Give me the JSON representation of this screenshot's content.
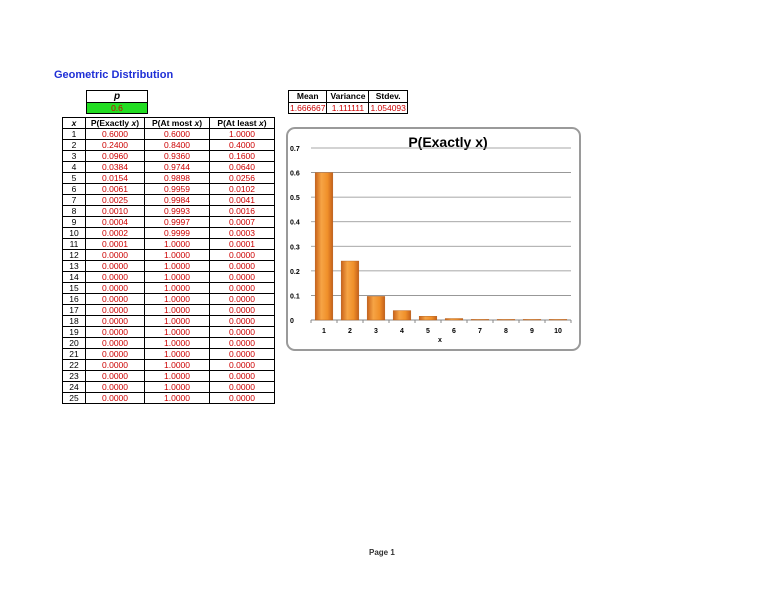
{
  "title": "Geometric Distribution",
  "param": {
    "label": "p",
    "value": "0.6"
  },
  "stats": {
    "headers": [
      "Mean",
      "Variance",
      "Stdev."
    ],
    "values": [
      "1.666667",
      "1.111111",
      "1.054093"
    ]
  },
  "table": {
    "headers": {
      "x": "x",
      "exactly_pre": "P(Exactly ",
      "atmost_pre": "P(At most ",
      "atleast_pre": "P(At least ",
      "var": "x",
      "close": ")"
    },
    "rows": [
      [
        "1",
        "0.6000",
        "0.6000",
        "1.0000"
      ],
      [
        "2",
        "0.2400",
        "0.8400",
        "0.4000"
      ],
      [
        "3",
        "0.0960",
        "0.9360",
        "0.1600"
      ],
      [
        "4",
        "0.0384",
        "0.9744",
        "0.0640"
      ],
      [
        "5",
        "0.0154",
        "0.9898",
        "0.0256"
      ],
      [
        "6",
        "0.0061",
        "0.9959",
        "0.0102"
      ],
      [
        "7",
        "0.0025",
        "0.9984",
        "0.0041"
      ],
      [
        "8",
        "0.0010",
        "0.9993",
        "0.0016"
      ],
      [
        "9",
        "0.0004",
        "0.9997",
        "0.0007"
      ],
      [
        "10",
        "0.0002",
        "0.9999",
        "0.0003"
      ],
      [
        "11",
        "0.0001",
        "1.0000",
        "0.0001"
      ],
      [
        "12",
        "0.0000",
        "1.0000",
        "0.0000"
      ],
      [
        "13",
        "0.0000",
        "1.0000",
        "0.0000"
      ],
      [
        "14",
        "0.0000",
        "1.0000",
        "0.0000"
      ],
      [
        "15",
        "0.0000",
        "1.0000",
        "0.0000"
      ],
      [
        "16",
        "0.0000",
        "1.0000",
        "0.0000"
      ],
      [
        "17",
        "0.0000",
        "1.0000",
        "0.0000"
      ],
      [
        "18",
        "0.0000",
        "1.0000",
        "0.0000"
      ],
      [
        "19",
        "0.0000",
        "1.0000",
        "0.0000"
      ],
      [
        "20",
        "0.0000",
        "1.0000",
        "0.0000"
      ],
      [
        "21",
        "0.0000",
        "1.0000",
        "0.0000"
      ],
      [
        "22",
        "0.0000",
        "1.0000",
        "0.0000"
      ],
      [
        "23",
        "0.0000",
        "1.0000",
        "0.0000"
      ],
      [
        "24",
        "0.0000",
        "1.0000",
        "0.0000"
      ],
      [
        "25",
        "0.0000",
        "1.0000",
        "0.0000"
      ]
    ]
  },
  "chart_data": {
    "type": "bar",
    "title": "P(Exactly x)",
    "xlabel": "x",
    "ylabel": "",
    "categories": [
      "1",
      "2",
      "3",
      "4",
      "5",
      "6",
      "7",
      "8",
      "9",
      "10"
    ],
    "values": [
      0.6,
      0.24,
      0.096,
      0.0384,
      0.0154,
      0.0061,
      0.0025,
      0.001,
      0.0004,
      0.0002
    ],
    "ylim": [
      0,
      0.7
    ],
    "yticks": [
      "0",
      "0.1",
      "0.2",
      "0.3",
      "0.4",
      "0.5",
      "0.6",
      "0.7"
    ],
    "grid": true,
    "bar_color": "#f0902a"
  },
  "footer": "Page 1"
}
